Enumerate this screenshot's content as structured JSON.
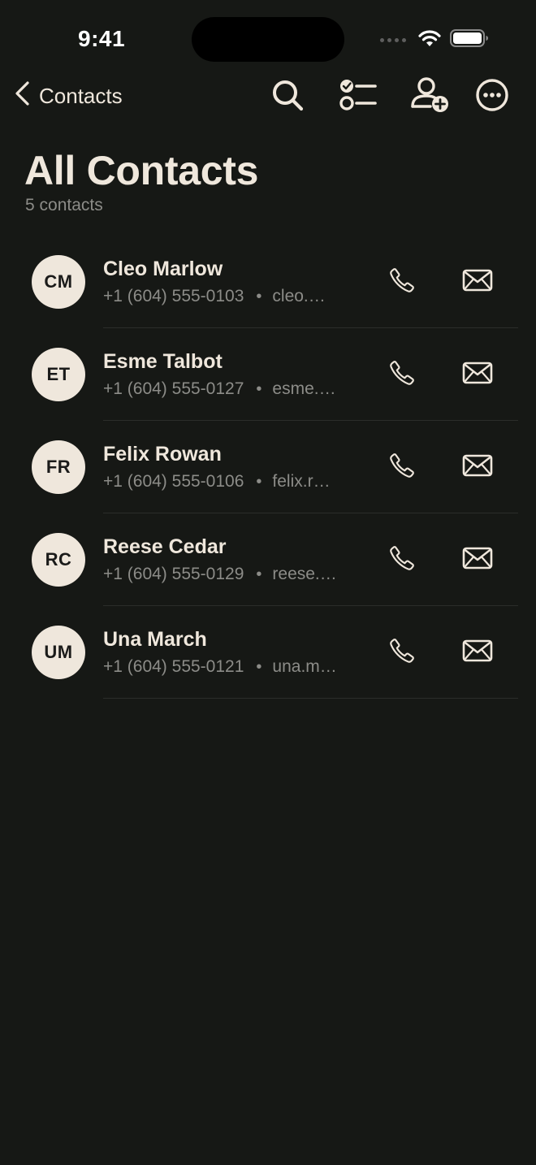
{
  "status_bar": {
    "time": "9:41"
  },
  "nav": {
    "back_label": "Contacts"
  },
  "header": {
    "title": "All Contacts",
    "subtitle": "5 contacts"
  },
  "contacts": [
    {
      "initials": "CM",
      "name": "Cleo Marlow",
      "phone": "+1 (604) 555-0103",
      "email": "cleo.…"
    },
    {
      "initials": "ET",
      "name": "Esme Talbot",
      "phone": "+1 (604) 555-0127",
      "email": "esme.…"
    },
    {
      "initials": "FR",
      "name": "Felix Rowan",
      "phone": "+1 (604) 555-0106",
      "email": "felix.r…"
    },
    {
      "initials": "RC",
      "name": "Reese Cedar",
      "phone": "+1 (604) 555-0129",
      "email": "reese.…"
    },
    {
      "initials": "UM",
      "name": "Una March",
      "phone": "+1 (604) 555-0121",
      "email": "una.m…"
    }
  ],
  "separator": "•",
  "colors": {
    "background": "#161815",
    "text": "#efe7dc",
    "secondary_text": "#8c8c88",
    "avatar_bg": "#efe7dc"
  },
  "icons": {
    "back": "chevron-left-icon",
    "search": "search-icon",
    "select": "checklist-icon",
    "add_contact": "person-add-icon",
    "more": "ellipsis-circle-icon",
    "call": "phone-icon",
    "email": "envelope-icon"
  }
}
